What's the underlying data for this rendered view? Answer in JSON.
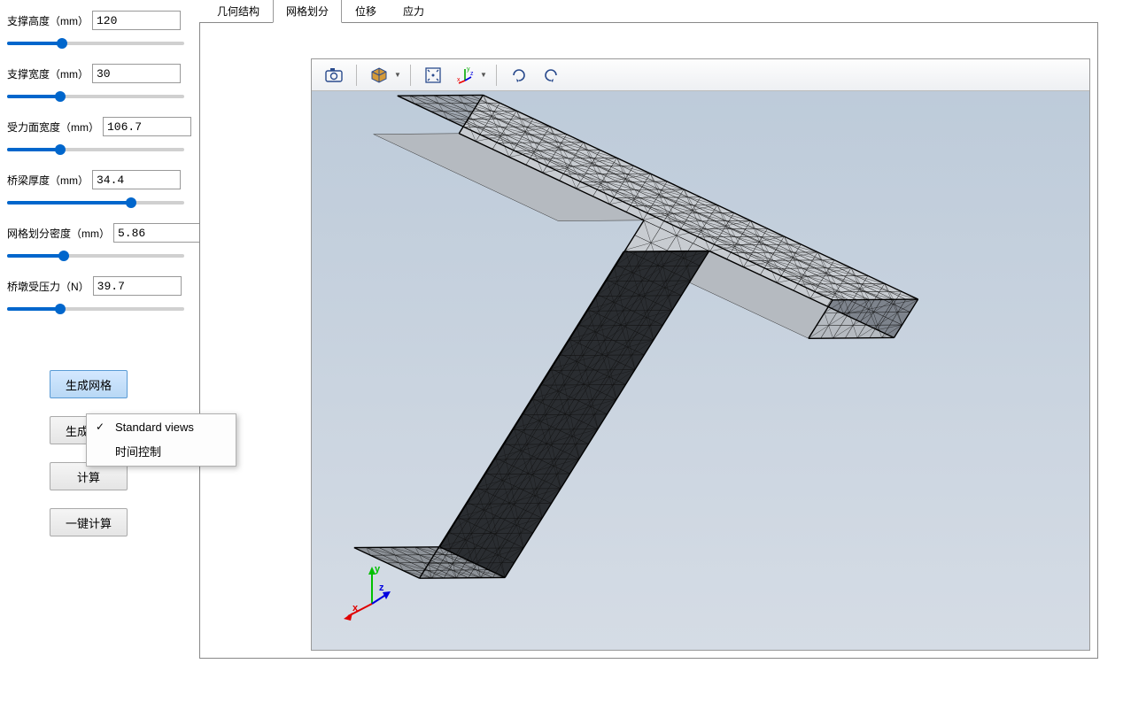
{
  "params": [
    {
      "label": "支撑高度（mm）",
      "value": "120",
      "pct": 31
    },
    {
      "label": "支撑宽度（mm）",
      "value": "30",
      "pct": 30
    },
    {
      "label": "受力面宽度（mm）",
      "value": "106.7",
      "pct": 30
    },
    {
      "label": "桥梁厚度（mm）",
      "value": "34.4",
      "pct": 70
    },
    {
      "label": "网格划分密度（mm）",
      "value": "5.86",
      "pct": 32
    },
    {
      "label": "桥墩受压力（N）",
      "value": "39.7",
      "pct": 30
    }
  ],
  "buttons": {
    "gen_mesh": "生成网格",
    "gen_geom": "生成几何",
    "compute": "计算",
    "one_click": "一键计算"
  },
  "tabs": [
    "几何结构",
    "网格划分",
    "位移",
    "应力"
  ],
  "active_tab": 1,
  "context_menu": {
    "items": [
      {
        "label": "Standard views",
        "checked": true
      },
      {
        "label": "时间控制",
        "checked": false
      }
    ]
  },
  "toolbar_icons": [
    "camera",
    "cube",
    "fit",
    "axes",
    "rotate-cw",
    "rotate-ccw"
  ],
  "axis_labels": {
    "x": "x",
    "y": "y",
    "z": "z"
  }
}
